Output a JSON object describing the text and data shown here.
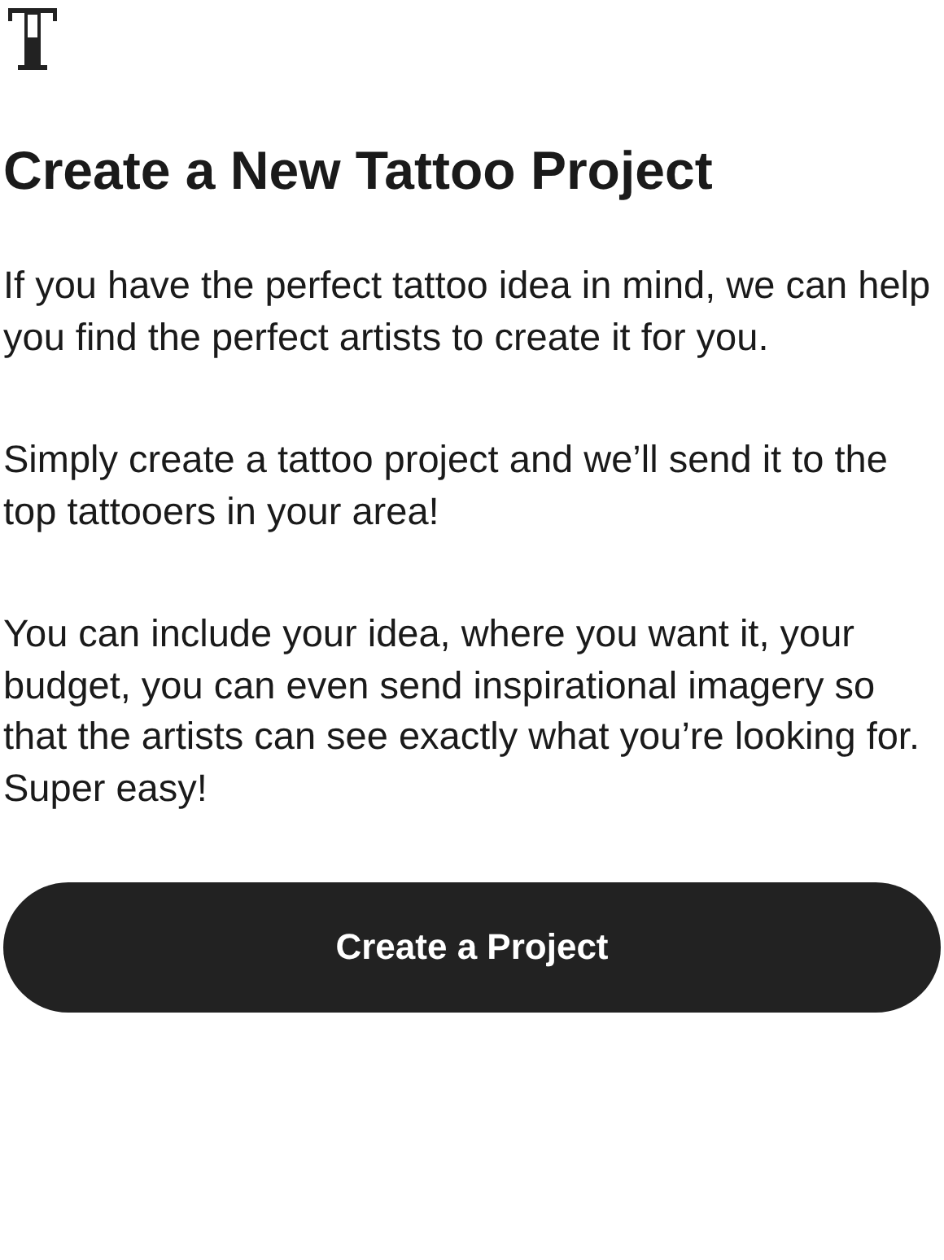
{
  "title": "Create a New Tattoo Project",
  "paragraphs": [
    "If you have the perfect tattoo idea in mind, we can help you find the perfect artists to create it for you.",
    "Simply create a tattoo project and we’ll send it to the top tattooers in your area!",
    "You can include your idea, where you want it, your budget, you can even send inspirational imagery so that the artists can see exactly what you’re looking for. Super easy!"
  ],
  "button": "Create a Project"
}
